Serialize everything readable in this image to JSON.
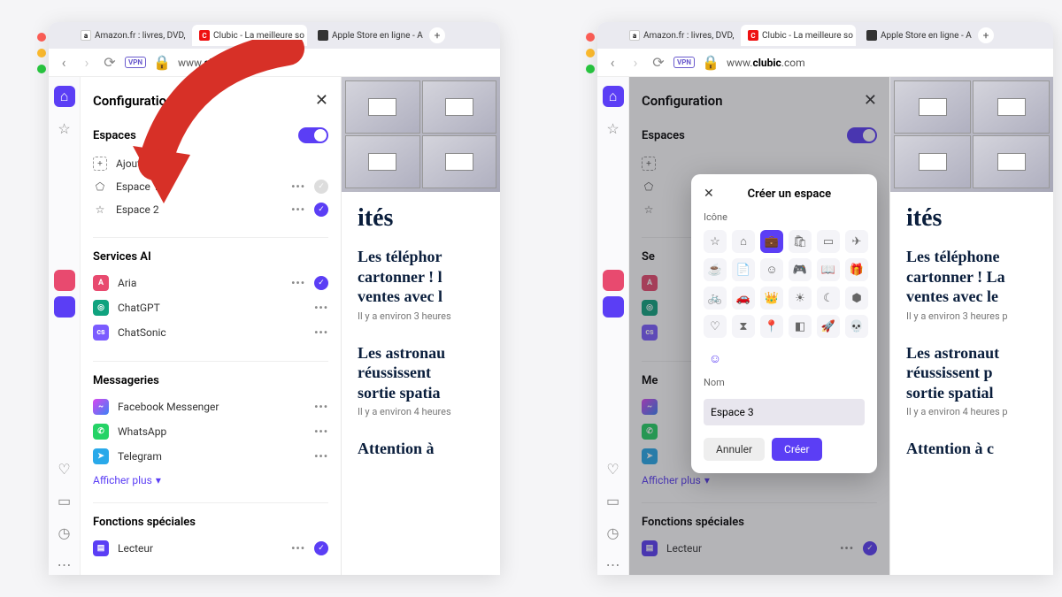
{
  "tabs": [
    {
      "label": "Amazon.fr : livres, DVD,",
      "fav": "amazon"
    },
    {
      "label": "Clubic - La meilleure so",
      "fav": "clubic"
    },
    {
      "label": "Apple Store en ligne - A",
      "fav": "apple"
    }
  ],
  "url_prefix": "www.",
  "url_domain_left": "cl",
  "url_domain": "clubic",
  "url_suffix": ".com",
  "panel": {
    "title": "Configuration",
    "espaces": {
      "title": "Espaces",
      "add": "Ajouter plus",
      "items": [
        {
          "label": "Espace 1",
          "checked": false
        },
        {
          "label": "Espace 2",
          "checked": true
        }
      ]
    },
    "ai": {
      "title": "Services AI",
      "items": [
        {
          "label": "Aria",
          "color": "#e84a6f",
          "checked": true,
          "dots": true
        },
        {
          "label": "ChatGPT",
          "color": "#10a37f",
          "checked": null,
          "dots": true
        },
        {
          "label": "ChatSonic",
          "color": "#7b5cff",
          "checked": null,
          "dots": true
        }
      ]
    },
    "msg": {
      "title": "Messageries",
      "items": [
        {
          "label": "Facebook Messenger",
          "color": "#d946ef"
        },
        {
          "label": "WhatsApp",
          "color": "#25d366"
        },
        {
          "label": "Telegram",
          "color": "#29a9ea"
        }
      ]
    },
    "showmore": "Afficher plus",
    "special": {
      "title": "Fonctions spéciales",
      "items": [
        {
          "label": "Lecteur",
          "color": "#5b3ef5",
          "checked": true
        }
      ]
    }
  },
  "content": {
    "headline_suffix": "ités",
    "articles": [
      {
        "title_left": "Les téléphor\ncartonner ! l\nventes avec l",
        "title_right": "Les téléphone\ncartonner ! La\nventes avec le",
        "meta": "Il y a environ 3 heures"
      },
      {
        "title_left": "Les astronau\nréussissent\nsortie spatia",
        "title_right": "Les astronaut\nréussissent p\nsortie spatial",
        "meta": "Il y a environ 4 heures"
      },
      {
        "title_left": "Attention à",
        "title_right": "Attention à c",
        "meta": ""
      }
    ]
  },
  "modal": {
    "title": "Créer un espace",
    "icon_label": "Icône",
    "name_label": "Nom",
    "name_value": "Espace 3",
    "cancel": "Annuler",
    "create": "Créer",
    "icons": [
      "☆",
      "⌂",
      "💼",
      "🛍",
      "▭",
      "✈",
      "☕",
      "📄",
      "☺",
      "🎮",
      "📖",
      "🎁",
      "🚲",
      "🚗",
      "👑",
      "☀",
      "☾",
      "⬢",
      "♡",
      "⧗",
      "📍",
      "◧",
      "🚀",
      "💀"
    ]
  }
}
